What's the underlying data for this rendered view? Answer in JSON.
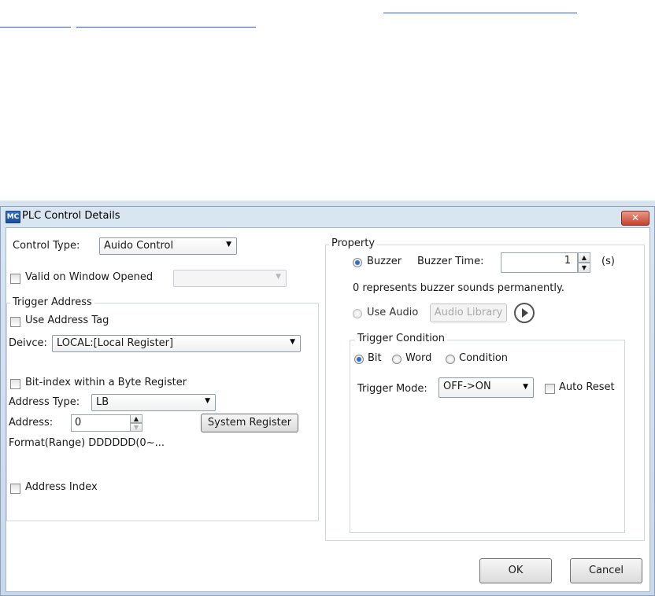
{
  "window": {
    "title": "PLC Control Details",
    "icon_text": "MC",
    "close_glyph": "✕"
  },
  "left": {
    "control_type_label": "Control Type:",
    "control_type_value": "Auido Control",
    "valid_on_window_label": "Valid on Window Opened",
    "valid_on_window_value": "",
    "trigger_group_title": "Trigger Address",
    "use_address_tag_label": "Use Address Tag",
    "device_label": "Deivce:",
    "device_value": "LOCAL:[Local Register]",
    "bit_index_label": "Bit-index within a Byte Register",
    "address_type_label": "Address Type:",
    "address_type_value": "LB",
    "address_label": "Address:",
    "address_value": "0",
    "system_register_button": "System Register",
    "format_text": "Format(Range) DDDDDD(0~...",
    "address_index_label": "Address Index"
  },
  "property": {
    "group_title": "Property",
    "buzzer_label": "Buzzer",
    "buzzer_time_label": "Buzzer Time:",
    "buzzer_time_value": "1",
    "buzzer_time_unit": "(s)",
    "note": "0 represents buzzer sounds permanently.",
    "use_audio_label": "Use Audio",
    "audio_library_button": "Audio Library",
    "trigger_condition": {
      "group_title": "Trigger Condition",
      "bit_label": "Bit",
      "word_label": "Word",
      "condition_label": "Condition",
      "trigger_mode_label": "Trigger Mode:",
      "trigger_mode_value": "OFF->ON",
      "auto_reset_label": "Auto Reset"
    }
  },
  "buttons": {
    "ok": "OK",
    "cancel": "Cancel"
  }
}
